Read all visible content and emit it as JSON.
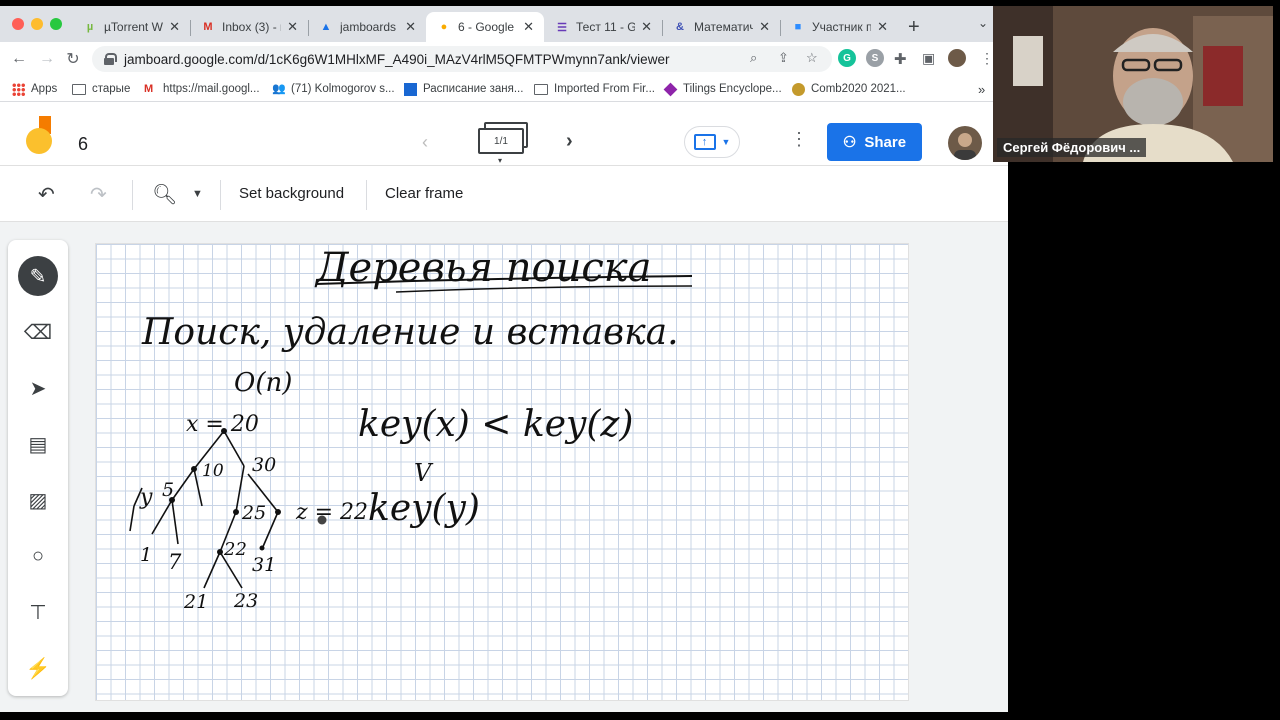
{
  "browser": {
    "tabs": [
      {
        "title": "µTorrent Web",
        "icon": "utorrent-icon",
        "icon_color": "#76b83f"
      },
      {
        "title": "Inbox (3) - n",
        "icon": "gmail-icon",
        "icon_color": "#d93025"
      },
      {
        "title": "jamboards -",
        "icon": "drive-icon",
        "icon_color": "#1a73e8"
      },
      {
        "title": "6 - Google Ja",
        "icon": "jamboard-icon",
        "icon_color": "#f9ab00",
        "active": true
      },
      {
        "title": "Тест 11 - Go",
        "icon": "forms-icon",
        "icon_color": "#673ab7"
      },
      {
        "title": "Математиче",
        "icon": "math-icon",
        "icon_color": "#3f51b5"
      },
      {
        "title": "Участник пу",
        "icon": "zoom-icon",
        "icon_color": "#2d8cff"
      }
    ],
    "url": "jamboard.google.com/d/1cK6g6W1MHlxMF_A490i_MAzV4rlM5QFMTPWmynn7ank/viewer",
    "bookmarks": [
      {
        "label": "Apps",
        "icon": "apps-grid-icon"
      },
      {
        "label": "старые",
        "icon": "folder-icon"
      },
      {
        "label": "https://mail.googl...",
        "icon": "gmail-icon"
      },
      {
        "label": "(71) Kolmogorov s...",
        "icon": "people-icon"
      },
      {
        "label": "Расписание заня...",
        "icon": "calendar-icon"
      },
      {
        "label": "Imported From Fir...",
        "icon": "folder-icon"
      },
      {
        "label": "Tilings Encyclope...",
        "icon": "tilings-icon"
      },
      {
        "label": "Comb2020 2021...",
        "icon": "comb-icon"
      }
    ]
  },
  "jamboard": {
    "title": "6",
    "frame_counter": "1/1",
    "share_label": "Share",
    "actions": {
      "set_background": "Set background",
      "clear_frame": "Clear frame"
    },
    "accent": "#1a73e8"
  },
  "board": {
    "title": "Деревья поиска",
    "line1": "Поиск, удаление и вставка.",
    "complexity": "O(n)",
    "root": "x = 20",
    "node_labels": [
      "10",
      "30",
      "5",
      "y",
      "25",
      "z = 22",
      "1",
      "7",
      "22",
      "31",
      "21",
      "23"
    ],
    "compare1": "key(x) < key(z)",
    "compare_arrow": "V",
    "compare2": "key(y)"
  },
  "video": {
    "participant_name": "Сергей Фёдорович ..."
  }
}
